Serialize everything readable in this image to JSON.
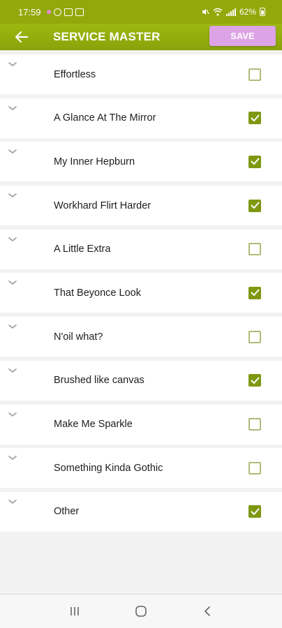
{
  "status_bar": {
    "time": "17:59",
    "battery": "62%"
  },
  "app_bar": {
    "title": "SERVICE MASTER",
    "save_label": "SAVE"
  },
  "colors": {
    "primary": "#93a80b",
    "save_button": "#dca4e6",
    "checked": "#7f9811"
  },
  "services": [
    {
      "label": "Effortless",
      "checked": false
    },
    {
      "label": "A Glance At The Mirror",
      "checked": true
    },
    {
      "label": "My Inner Hepburn",
      "checked": true
    },
    {
      "label": "Workhard Flirt Harder",
      "checked": true
    },
    {
      "label": "A Little Extra",
      "checked": false
    },
    {
      "label": "That Beyonce Look",
      "checked": true
    },
    {
      "label": "N'oil what?",
      "checked": false
    },
    {
      "label": "Brushed like canvas",
      "checked": true
    },
    {
      "label": "Make Me Sparkle",
      "checked": false
    },
    {
      "label": "Something Kinda Gothic",
      "checked": false
    },
    {
      "label": "Other",
      "checked": true
    }
  ],
  "icons": {
    "back": "arrow-left-icon",
    "expand": "chevron-down-icon",
    "check": "check-icon",
    "nav_recent": "recent-apps-icon",
    "nav_home": "home-icon",
    "nav_back": "back-icon"
  }
}
